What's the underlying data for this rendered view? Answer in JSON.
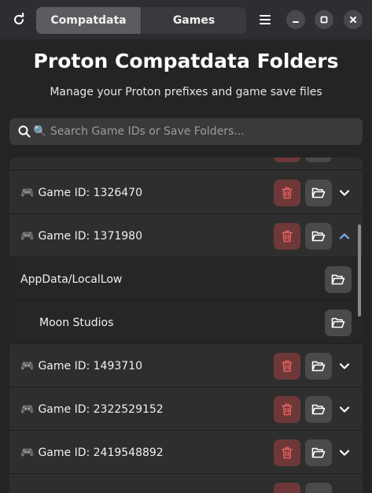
{
  "header": {
    "tabs": [
      {
        "label": "Compatdata",
        "active": true
      },
      {
        "label": "Games",
        "active": false
      }
    ]
  },
  "main": {
    "title": "Proton Compatdata Folders",
    "subtitle": "Manage your Proton prefixes and game save files",
    "search": {
      "placeholder": "🔍 Search Game IDs or Save Folders...",
      "value": ""
    },
    "rows": [
      {
        "type": "game",
        "label": "Game ID: 1326470",
        "expanded": false
      },
      {
        "type": "game",
        "label": "Game ID: 1371980",
        "expanded": true
      },
      {
        "type": "folder",
        "label": "AppData/LocalLow"
      },
      {
        "type": "subfolder",
        "label": "Moon Studios"
      },
      {
        "type": "game",
        "label": "Game ID: 1493710",
        "expanded": false
      },
      {
        "type": "game",
        "label": "Game ID: 2322529152",
        "expanded": false
      },
      {
        "type": "game",
        "label": "Game ID: 2419548892",
        "expanded": false
      }
    ]
  },
  "colors": {
    "accent": "#78aeed",
    "destructive": "#6e3838",
    "destructive_icon": "#e66161"
  }
}
